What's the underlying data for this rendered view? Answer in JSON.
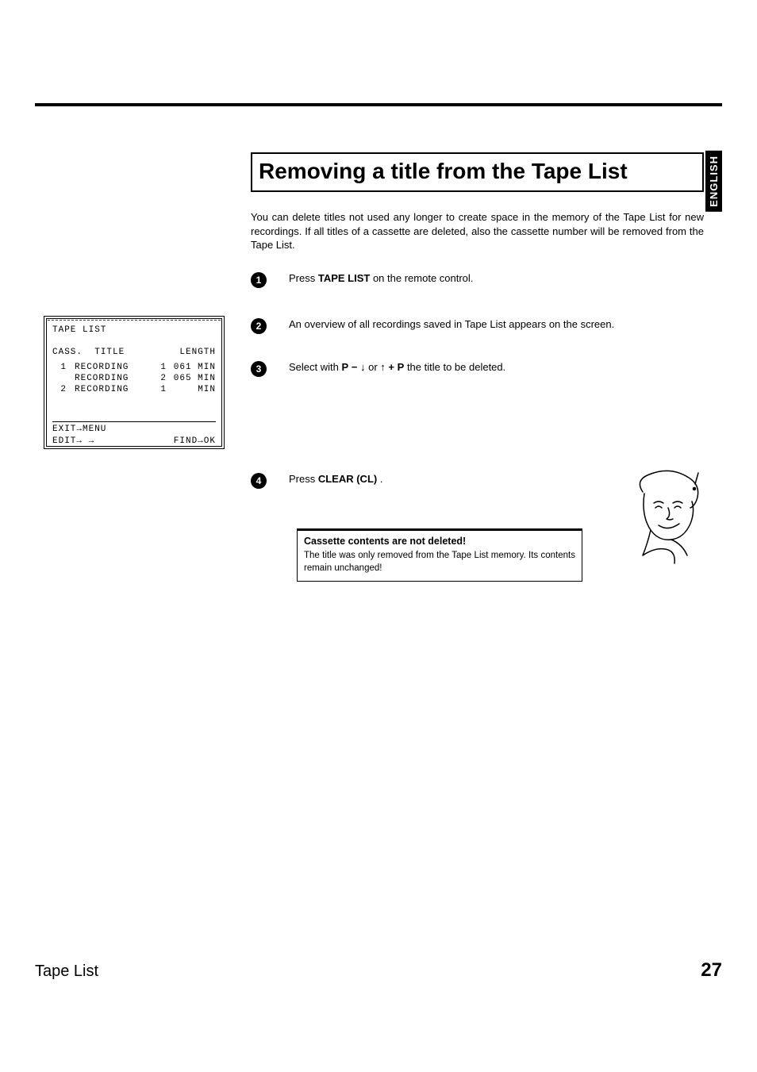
{
  "language_tab": "ENGLISH",
  "section_title": "Removing a title from the Tape List",
  "intro": "You can delete titles not used any longer to create space in the memory of the Tape List for new recordings. If all titles of a cassette are deleted, also the cassette number will be removed from the Tape List.",
  "steps": {
    "s1": {
      "num": "1",
      "pre": "Press ",
      "btn": "TAPE LIST",
      "post": " on the remote control."
    },
    "s2": {
      "num": "2",
      "text": "An overview of all recordings saved in Tape List appears on the screen."
    },
    "s3": {
      "num": "3",
      "pre": "Select with ",
      "p": "P",
      "minus": "−",
      "down": "↓",
      "or": " or ",
      "up": "↑",
      "plus": "+",
      "p2": "P",
      "post": " the title to be deleted."
    },
    "s4": {
      "num": "4",
      "pre": "Press ",
      "btn": "CLEAR (CL)",
      "post": " ."
    }
  },
  "screen": {
    "title": "TAPE LIST",
    "col_cass": "CASS.",
    "col_title": "TITLE",
    "col_length": "LENGTH",
    "rows": [
      {
        "cass": "1",
        "title": "RECORDING",
        "idx": "1",
        "len": "061 MIN"
      },
      {
        "cass": "",
        "title": "RECORDING",
        "idx": "2",
        "len": "065 MIN"
      },
      {
        "cass": "2",
        "title": "RECORDING",
        "idx": "1",
        "len": "MIN"
      }
    ],
    "exit": "EXIT→MENU",
    "edit": "EDIT→ →",
    "find": "FIND→OK"
  },
  "note": {
    "title": "Cassette contents are not deleted!",
    "text": "The title was only removed from the Tape List memory. Its contents remain unchanged!"
  },
  "footer": {
    "left": "Tape List",
    "page": "27"
  }
}
